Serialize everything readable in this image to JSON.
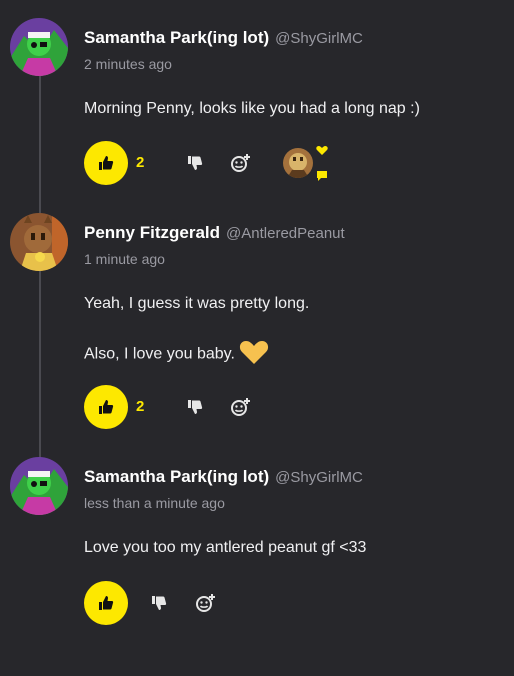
{
  "comments": [
    {
      "author": "Samantha Park(ing lot)",
      "handle": "@ShyGirlMC",
      "time": "2 minutes ago",
      "lines": [
        "Morning Penny, looks like you had a long nap :)"
      ],
      "likes": "2"
    },
    {
      "author": "Penny Fitzgerald",
      "handle": "@AntleredPeanut",
      "time": "1 minute ago",
      "lines": [
        "Yeah, I guess it was pretty long.",
        "Also, I love you baby."
      ],
      "likes": "2"
    },
    {
      "author": "Samantha Park(ing lot)",
      "handle": "@ShyGirlMC",
      "time": "less than a minute ago",
      "lines": [
        "Love you too my antlered peanut gf <33"
      ],
      "likes": ""
    }
  ],
  "icons": {
    "like": "thumbs-up-icon",
    "dislike": "thumbs-down-icon",
    "react": "add-reaction-icon",
    "heart": "yellow-heart-emoji"
  },
  "colors": {
    "background": "#27272b",
    "accent": "#fde800",
    "muted": "#9a9aa2"
  }
}
